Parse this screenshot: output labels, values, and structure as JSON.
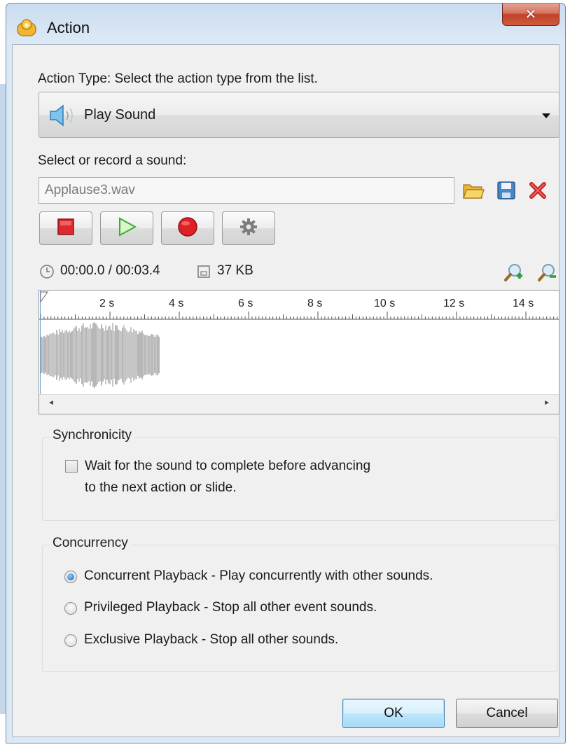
{
  "window": {
    "title": "Action",
    "close_glyph": "✕"
  },
  "action_type": {
    "label": "Action Type: Select the action type from the list.",
    "selected": "Play Sound",
    "icon": "speaker-icon"
  },
  "sound": {
    "label": "Select or record a sound:",
    "filename": "Applause3.wav",
    "icons": [
      "open-folder-icon",
      "save-icon",
      "delete-icon"
    ],
    "controls": [
      "stop-icon",
      "play-icon",
      "record-icon",
      "settings-icon"
    ],
    "time": "00:00.0 / 00:03.4",
    "size": "37 KB",
    "zoom_icons": [
      "zoom-in-icon",
      "zoom-out-icon"
    ]
  },
  "waveform": {
    "ruler_labels": [
      "2 s",
      "4 s",
      "6 s",
      "8 s",
      "10 s",
      "12 s",
      "14 s"
    ],
    "scroll_left": "◄",
    "scroll_right": "►"
  },
  "synchronicity": {
    "title": "Synchronicity",
    "checkbox_line1": "Wait for the sound to complete before advancing",
    "checkbox_line2": "to the next action or slide.",
    "checked": false
  },
  "concurrency": {
    "title": "Concurrency",
    "options": [
      {
        "label": "Concurrent Playback - Play concurrently with other sounds.",
        "selected": true
      },
      {
        "label": "Privileged Playback - Stop all other event sounds.",
        "selected": false
      },
      {
        "label": "Exclusive Playback - Stop all other sounds.",
        "selected": false
      }
    ]
  },
  "buttons": {
    "ok": "OK",
    "cancel": "Cancel"
  },
  "colors": {
    "accent": "#1565b8",
    "close_red": "#c14229",
    "stop_red": "#e0282f",
    "play_green": "#37b02b"
  }
}
